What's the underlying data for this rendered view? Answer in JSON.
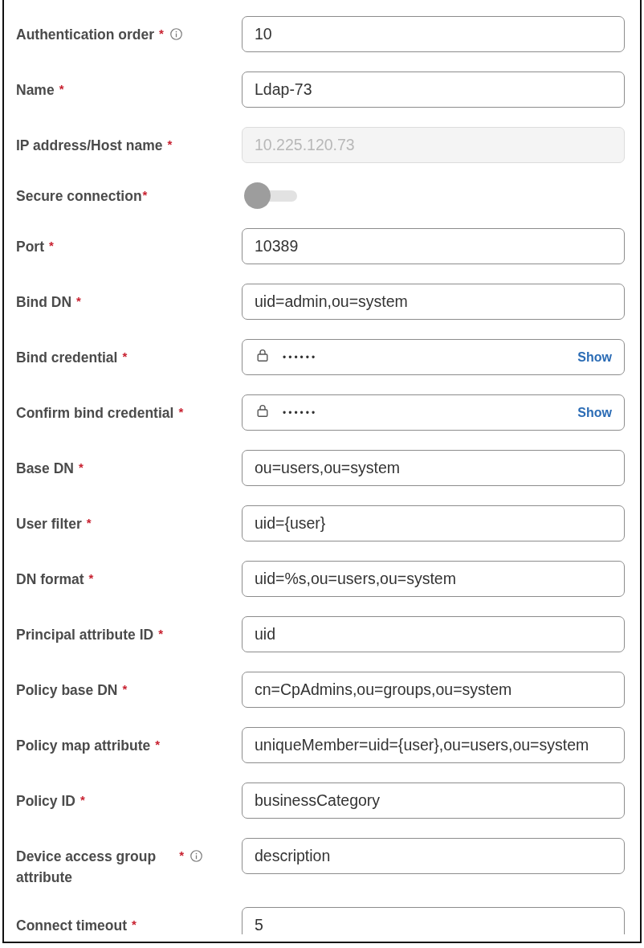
{
  "form": {
    "fields": [
      {
        "kind": "text",
        "label": "Authentication order",
        "required_mark": "*",
        "info": true,
        "disabled": false,
        "value": "10"
      },
      {
        "kind": "text",
        "label": "Name",
        "required_mark": "*",
        "info": false,
        "disabled": false,
        "value": "Ldap-73"
      },
      {
        "kind": "text",
        "label": "IP address/Host name",
        "required_mark": "*",
        "info": false,
        "disabled": true,
        "value": "10.225.120.73"
      },
      {
        "kind": "toggle",
        "label": "Secure connection",
        "required_mark": "*",
        "info": false,
        "disabled": false,
        "on": false
      },
      {
        "kind": "text",
        "label": "Port",
        "required_mark": "*",
        "info": false,
        "disabled": false,
        "value": "10389"
      },
      {
        "kind": "text",
        "label": "Bind DN",
        "required_mark": "*",
        "info": false,
        "disabled": false,
        "value": "uid=admin,ou=system"
      },
      {
        "kind": "password",
        "label": "Bind credential",
        "required_mark": "*",
        "info": false,
        "disabled": false,
        "value": "••••••",
        "reveal_label": "Show"
      },
      {
        "kind": "password",
        "label": "Confirm bind credential",
        "required_mark": "*",
        "info": false,
        "disabled": false,
        "value": "••••••",
        "reveal_label": "Show"
      },
      {
        "kind": "text",
        "label": "Base DN",
        "required_mark": "*",
        "info": false,
        "disabled": false,
        "value": "ou=users,ou=system"
      },
      {
        "kind": "text",
        "label": "User filter",
        "required_mark": "*",
        "info": false,
        "disabled": false,
        "value": "uid={user}"
      },
      {
        "kind": "text",
        "label": "DN format",
        "required_mark": "*",
        "info": false,
        "disabled": false,
        "value": "uid=%s,ou=users,ou=system"
      },
      {
        "kind": "text",
        "label": "Principal attribute ID",
        "required_mark": "*",
        "info": false,
        "disabled": false,
        "value": "uid"
      },
      {
        "kind": "text",
        "label": "Policy base DN",
        "required_mark": "*",
        "info": false,
        "disabled": false,
        "value": "cn=CpAdmins,ou=groups,ou=system"
      },
      {
        "kind": "text",
        "label": "Policy map attribute",
        "required_mark": "*",
        "info": false,
        "disabled": false,
        "value": "uniqueMember=uid={user},ou=users,ou=system"
      },
      {
        "kind": "text",
        "label": "Policy ID",
        "required_mark": "*",
        "info": false,
        "disabled": false,
        "value": "businessCategory"
      },
      {
        "kind": "text",
        "label": "Device access group attribute",
        "required_mark": "*",
        "info": true,
        "disabled": false,
        "value": "description"
      },
      {
        "kind": "text",
        "label": "Connect timeout",
        "required_mark": "*",
        "info": false,
        "disabled": false,
        "value": "5"
      }
    ]
  }
}
